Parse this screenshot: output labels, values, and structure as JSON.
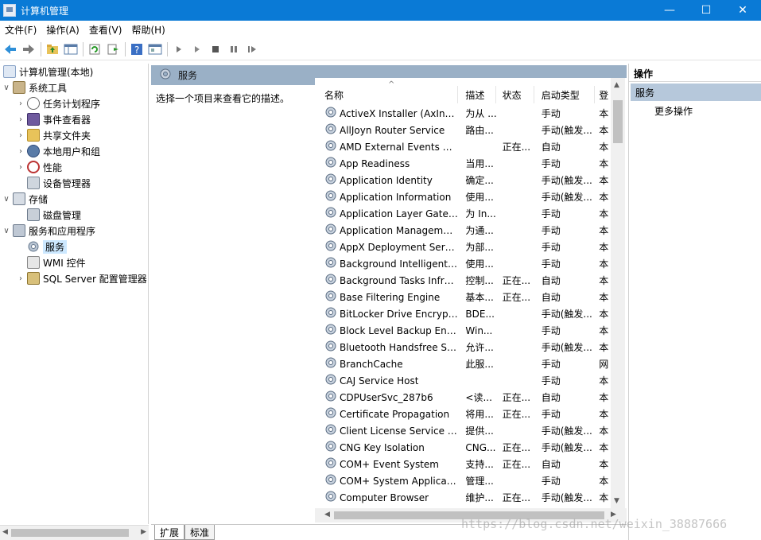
{
  "window": {
    "title": "计算机管理",
    "minimize_glyph": "—",
    "maximize_glyph": "☐",
    "close_glyph": "✕"
  },
  "menubar": {
    "items": [
      {
        "label": "文件(F)"
      },
      {
        "label": "操作(A)"
      },
      {
        "label": "查看(V)"
      },
      {
        "label": "帮助(H)"
      }
    ]
  },
  "toolbar": {
    "icons": [
      "back-icon",
      "forward-icon",
      "up-folder-icon",
      "show-hide-tree-icon",
      "refresh-icon",
      "export-list-icon",
      "help-icon",
      "properties-icon",
      "start-service-icon",
      "start-service-alt-icon",
      "stop-service-icon",
      "pause-service-icon",
      "restart-service-icon"
    ]
  },
  "tree": {
    "items": [
      {
        "label": "计算机管理(本地)",
        "icon": "computer-management-icon",
        "expanded": true
      },
      {
        "label": "系统工具",
        "icon": "system-tools-icon",
        "expanded": true
      },
      {
        "label": "任务计划程序",
        "icon": "task-scheduler-icon",
        "collapsed": true
      },
      {
        "label": "事件查看器",
        "icon": "event-viewer-icon",
        "collapsed": true
      },
      {
        "label": "共享文件夹",
        "icon": "shared-folders-icon",
        "collapsed": true
      },
      {
        "label": "本地用户和组",
        "icon": "local-users-icon",
        "collapsed": true
      },
      {
        "label": "性能",
        "icon": "performance-icon",
        "collapsed": true
      },
      {
        "label": "设备管理器",
        "icon": "device-manager-icon"
      },
      {
        "label": "存储",
        "icon": "storage-icon",
        "expanded": true
      },
      {
        "label": "磁盘管理",
        "icon": "disk-management-icon"
      },
      {
        "label": "服务和应用程序",
        "icon": "services-applications-icon",
        "expanded": true
      },
      {
        "label": "服务",
        "icon": "services-icon",
        "selected": true
      },
      {
        "label": "WMI 控件",
        "icon": "wmi-control-icon"
      },
      {
        "label": "SQL Server 配置管理器",
        "icon": "sql-server-config-icon",
        "collapsed": true
      }
    ]
  },
  "middle": {
    "header_title": "服务",
    "description_prompt": "选择一个项目来查看它的描述。"
  },
  "services_table": {
    "columns": {
      "name": "名称",
      "description": "描述",
      "status": "状态",
      "startup_type": "启动类型",
      "logon_as": "登"
    },
    "rows": [
      {
        "name": "ActiveX Installer (AxInstSV)",
        "description": "为从 ...",
        "status": "",
        "startup": "手动",
        "logon": "本"
      },
      {
        "name": "AllJoyn Router Service",
        "description": "路由...",
        "status": "",
        "startup": "手动(触发...",
        "logon": "本"
      },
      {
        "name": "AMD External Events Utility",
        "description": "",
        "status": "正在...",
        "startup": "自动",
        "logon": "本"
      },
      {
        "name": "App Readiness",
        "description": "当用...",
        "status": "",
        "startup": "手动",
        "logon": "本"
      },
      {
        "name": "Application Identity",
        "description": "确定...",
        "status": "",
        "startup": "手动(触发...",
        "logon": "本"
      },
      {
        "name": "Application Information",
        "description": "使用...",
        "status": "",
        "startup": "手动(触发...",
        "logon": "本"
      },
      {
        "name": "Application Layer Gatewa...",
        "description": "为 In...",
        "status": "",
        "startup": "手动",
        "logon": "本"
      },
      {
        "name": "Application Management",
        "description": "为通...",
        "status": "",
        "startup": "手动",
        "logon": "本"
      },
      {
        "name": "AppX Deployment Servic...",
        "description": "为部...",
        "status": "",
        "startup": "手动",
        "logon": "本"
      },
      {
        "name": "Background Intelligent T...",
        "description": "使用...",
        "status": "",
        "startup": "手动",
        "logon": "本"
      },
      {
        "name": "Background Tasks Infras...",
        "description": "控制...",
        "status": "正在...",
        "startup": "自动",
        "logon": "本"
      },
      {
        "name": "Base Filtering Engine",
        "description": "基本...",
        "status": "正在...",
        "startup": "自动",
        "logon": "本"
      },
      {
        "name": "BitLocker Drive Encryptio...",
        "description": "BDE...",
        "status": "",
        "startup": "手动(触发...",
        "logon": "本"
      },
      {
        "name": "Block Level Backup Engi...",
        "description": "Win...",
        "status": "",
        "startup": "手动",
        "logon": "本"
      },
      {
        "name": "Bluetooth Handsfree Ser...",
        "description": "允许...",
        "status": "",
        "startup": "手动(触发...",
        "logon": "本"
      },
      {
        "name": "BranchCache",
        "description": "此服...",
        "status": "",
        "startup": "手动",
        "logon": "网"
      },
      {
        "name": "CAJ Service Host",
        "description": "",
        "status": "",
        "startup": "手动",
        "logon": "本"
      },
      {
        "name": "CDPUserSvc_287b6",
        "description": "<读...",
        "status": "正在...",
        "startup": "自动",
        "logon": "本"
      },
      {
        "name": "Certificate Propagation",
        "description": "将用...",
        "status": "正在...",
        "startup": "手动",
        "logon": "本"
      },
      {
        "name": "Client License Service (Cli...",
        "description": "提供...",
        "status": "",
        "startup": "手动(触发...",
        "logon": "本"
      },
      {
        "name": "CNG Key Isolation",
        "description": "CNG...",
        "status": "正在...",
        "startup": "手动(触发...",
        "logon": "本"
      },
      {
        "name": "COM+ Event System",
        "description": "支持...",
        "status": "正在...",
        "startup": "自动",
        "logon": "本"
      },
      {
        "name": "COM+ System Application",
        "description": "管理...",
        "status": "",
        "startup": "手动",
        "logon": "本"
      },
      {
        "name": "Computer Browser",
        "description": "维护...",
        "status": "正在...",
        "startup": "手动(触发...",
        "logon": "本"
      }
    ]
  },
  "bottom_tabs": [
    {
      "label": "扩展"
    },
    {
      "label": "标准"
    }
  ],
  "actions": {
    "header": "操作",
    "section": "服务",
    "more": "更多操作"
  },
  "watermark": "https://blog.csdn.net/weixin_38887666",
  "colors": {
    "titlebar": "#0a7ad6",
    "panel_header": "#9ab0c6",
    "selection": "#cce8ff",
    "action_section": "#b6c8db"
  }
}
